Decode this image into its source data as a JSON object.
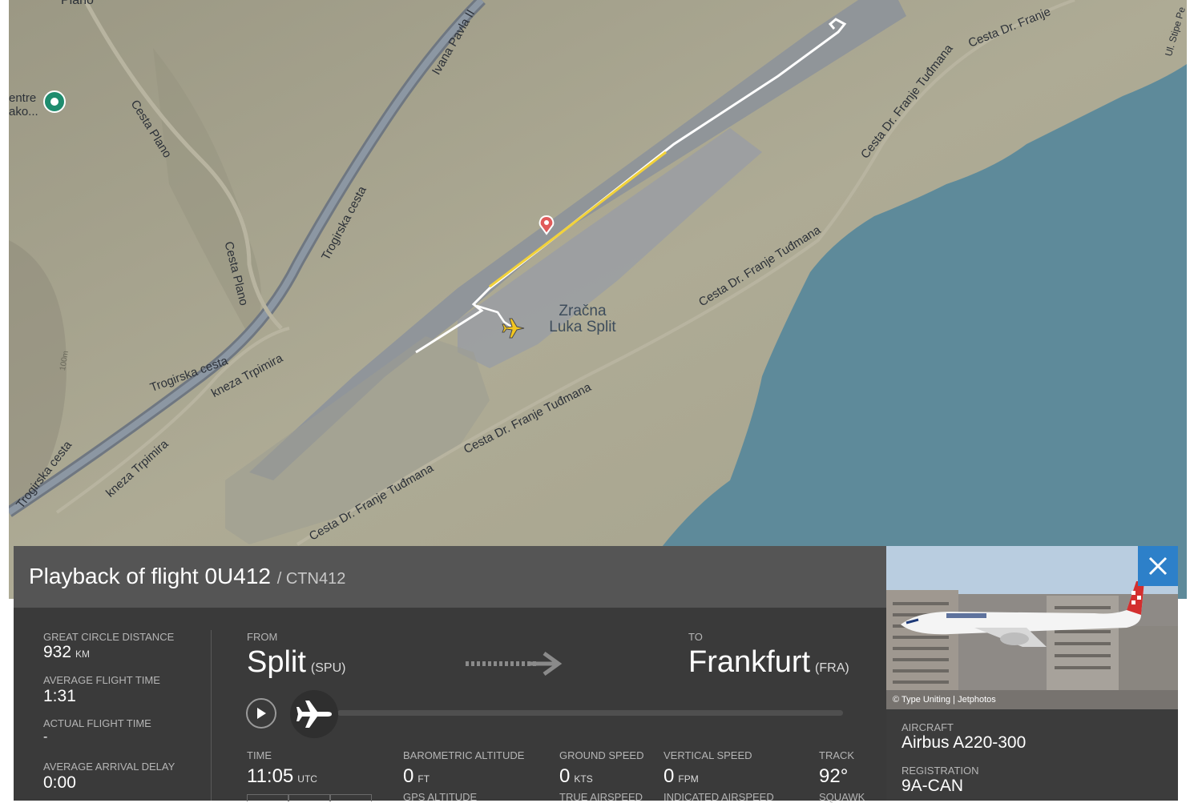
{
  "map": {
    "airport_label": "Zračna\nLuka Split",
    "poi_label": "entre\nako...",
    "top_label": "Plano",
    "streets": [
      {
        "id": "cesta-plano-upper",
        "text": "Cesta Plano"
      },
      {
        "id": "cesta-plano-lower",
        "text": "Cesta Plano"
      },
      {
        "id": "ivana-pavla",
        "text": "Ivana Pavla II"
      },
      {
        "id": "trogirska-1",
        "text": "Trogirska cesta"
      },
      {
        "id": "trogirska-2",
        "text": "Trogirska cesta"
      },
      {
        "id": "trogirska-3",
        "text": "Trogirska cesta"
      },
      {
        "id": "kneza-1",
        "text": "kneza Trpimira"
      },
      {
        "id": "kneza-2",
        "text": "kneza Trpimira"
      },
      {
        "id": "tudmana-1",
        "text": "Cesta Dr. Franje Tuđmana"
      },
      {
        "id": "tudmana-2",
        "text": "Cesta Dr. Franje Tuđmana"
      },
      {
        "id": "tudmana-3",
        "text": "Cesta Dr. Franje Tuđmana"
      },
      {
        "id": "tudmana-4",
        "text": "Cesta Dr. Franje Tuđmana"
      },
      {
        "id": "tudmana-5",
        "text": "Cesta Dr. Franje"
      },
      {
        "id": "stipe",
        "text": "Ul. Stipe Pe"
      },
      {
        "id": "contour",
        "text": "100m"
      }
    ],
    "colors": {
      "land": "#a9a690",
      "water": "#5e8a9a",
      "airport": "#8e939a",
      "track": "#ffffff",
      "track_highlight": "#f2d23a"
    }
  },
  "flight": {
    "title": "Playback of flight 0U412",
    "subtitle": "/ CTN412",
    "stats": {
      "great_circle_distance_label": "GREAT CIRCLE DISTANCE",
      "great_circle_distance_value": "932",
      "great_circle_distance_unit": "KM",
      "avg_flight_time_label": "AVERAGE FLIGHT TIME",
      "avg_flight_time_value": "1:31",
      "actual_flight_time_label": "ACTUAL FLIGHT TIME",
      "actual_flight_time_value": "-",
      "avg_arrival_delay_label": "AVERAGE ARRIVAL DELAY",
      "avg_arrival_delay_value": "0:00"
    },
    "from_label": "FROM",
    "from_city": "Split",
    "from_code": "(SPU)",
    "to_label": "TO",
    "to_city": "Frankfurt",
    "to_code": "(FRA)",
    "progress": 0.0,
    "time_label": "TIME",
    "time_value": "11:05",
    "time_unit": "UTC",
    "baro_alt_label": "BAROMETRIC ALTITUDE",
    "baro_alt_value": "0",
    "baro_alt_unit": "FT",
    "gps_alt_label": "GPS ALTITUDE",
    "ground_speed_label": "GROUND SPEED",
    "ground_speed_value": "0",
    "ground_speed_unit": "KTS",
    "true_airspeed_label": "TRUE AIRSPEED",
    "vertical_speed_label": "VERTICAL SPEED",
    "vertical_speed_value": "0",
    "vertical_speed_unit": "FPM",
    "indicated_airspeed_label": "INDICATED AIRSPEED",
    "track_label": "TRACK",
    "track_value": "92°",
    "squawk_label": "SQUAWK"
  },
  "aircraft": {
    "photo_credit": "© Type Uniting | Jetphotos",
    "aircraft_label": "AIRCRAFT",
    "aircraft_value": "Airbus A220-300",
    "registration_label": "REGISTRATION",
    "registration_value": "9A-CAN"
  },
  "icons": [
    "close-icon",
    "play-icon",
    "plane-icon",
    "arrow-right-icon",
    "map-pin-icon",
    "poi-icon",
    "aircraft-marker-icon"
  ]
}
